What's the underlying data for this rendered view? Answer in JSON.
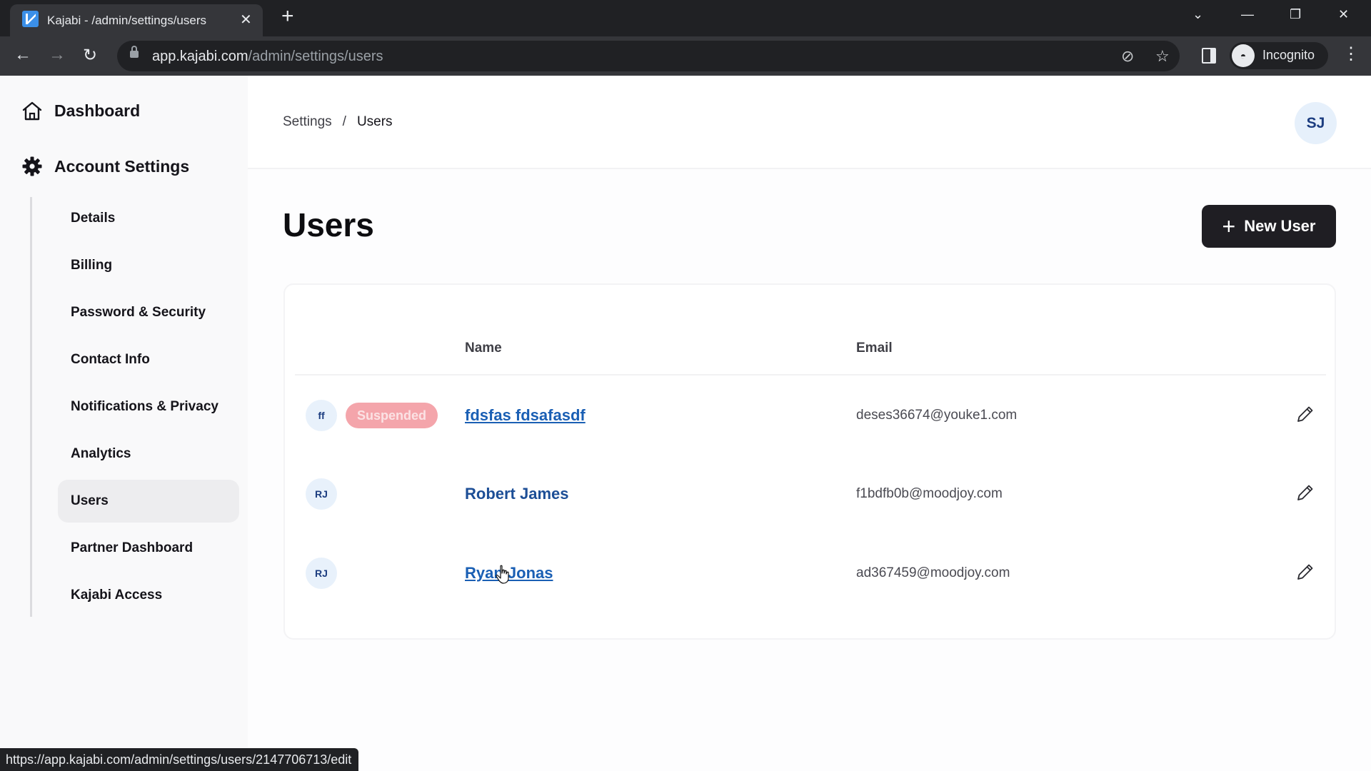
{
  "browser": {
    "tab_title": "Kajabi - /admin/settings/users",
    "url_host": "app.kajabi.com",
    "url_path": "/admin/settings/users",
    "profile_label": "Incognito",
    "status_url": "https://app.kajabi.com/admin/settings/users/2147706713/edit"
  },
  "sidebar": {
    "dashboard_label": "Dashboard",
    "account_settings_label": "Account Settings",
    "items": [
      {
        "label": "Details"
      },
      {
        "label": "Billing"
      },
      {
        "label": "Password & Security"
      },
      {
        "label": "Contact Info"
      },
      {
        "label": "Notifications & Privacy"
      },
      {
        "label": "Analytics"
      },
      {
        "label": "Users",
        "active": true
      },
      {
        "label": "Partner Dashboard"
      },
      {
        "label": "Kajabi Access"
      }
    ]
  },
  "header": {
    "breadcrumb": [
      "Settings",
      "Users"
    ],
    "breadcrumb_separator": "/",
    "user_initials": "SJ"
  },
  "page": {
    "title": "Users",
    "new_user_label": "New User"
  },
  "table": {
    "columns": [
      "Name",
      "Email"
    ],
    "rows": [
      {
        "initials": "ff",
        "status": "Suspended",
        "name": "fdsfas fdsafasdf",
        "email": "deses36674@youke1.com"
      },
      {
        "initials": "RJ",
        "status": "",
        "name": "Robert James",
        "email": "f1bdfb0b@moodjoy.com"
      },
      {
        "initials": "RJ",
        "status": "",
        "name": "Ryan Jonas",
        "email": "ad367459@moodjoy.com"
      }
    ]
  },
  "colors": {
    "accent_link": "#1a5fb4",
    "primary_button": "#1f1e23",
    "suspended_badge": "#f4a5ab"
  }
}
